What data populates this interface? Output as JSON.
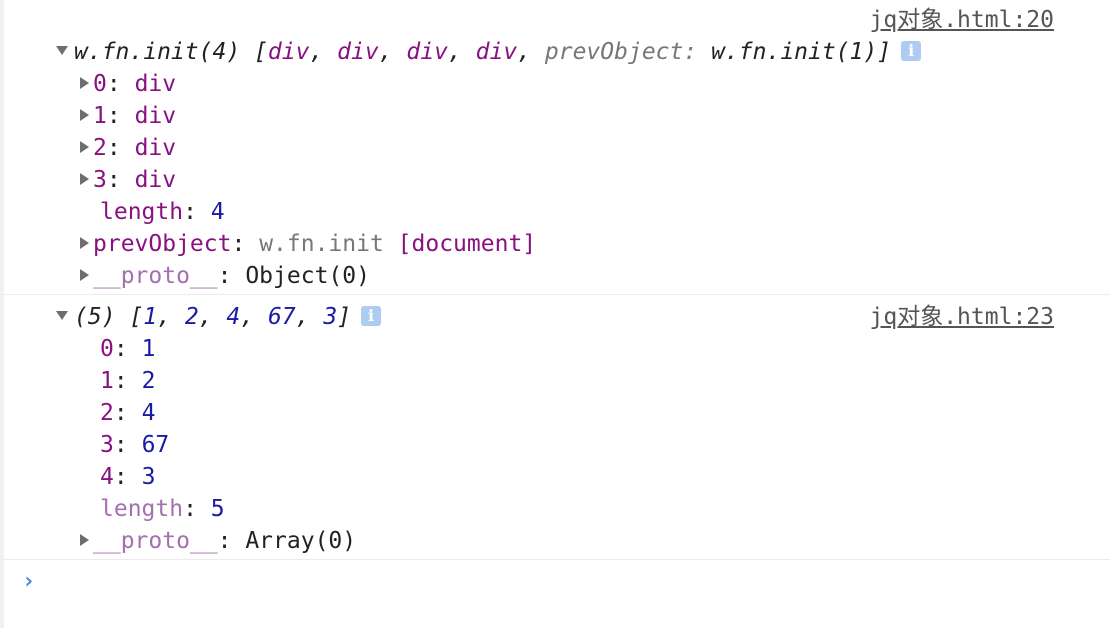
{
  "messages": [
    {
      "source": "jq对象.html:20",
      "header": {
        "ctor": "w.fn.init(4)",
        "open": "[",
        "items": [
          "div",
          "div",
          "div",
          "div"
        ],
        "sep": ", ",
        "prev_key": "prevObject",
        "colon": ": ",
        "prev_val": "w.fn.init(1)",
        "close": "]"
      },
      "children": [
        {
          "key": "0",
          "value": "div"
        },
        {
          "key": "1",
          "value": "div"
        },
        {
          "key": "2",
          "value": "div"
        },
        {
          "key": "3",
          "value": "div"
        }
      ],
      "length": {
        "key": "length",
        "value": "4"
      },
      "prev": {
        "key": "prevObject",
        "ctor": "w.fn.init",
        "value": "[document]"
      },
      "proto": {
        "key": "__proto__",
        "value": "Object(0)"
      }
    },
    {
      "source": "jq对象.html:23",
      "header": {
        "count": "(5)",
        "open": "[",
        "items": [
          "1",
          "2",
          "4",
          "67",
          "3"
        ],
        "sep": ", ",
        "close": "]"
      },
      "children": [
        {
          "key": "0",
          "value": "1"
        },
        {
          "key": "1",
          "value": "2"
        },
        {
          "key": "2",
          "value": "4"
        },
        {
          "key": "3",
          "value": "67"
        },
        {
          "key": "4",
          "value": "3"
        }
      ],
      "length": {
        "key": "length",
        "value": "5"
      },
      "proto": {
        "key": "__proto__",
        "value": "Array(0)"
      }
    }
  ],
  "console": {
    "prompt": "›",
    "info_glyph": "i"
  },
  "colors": {
    "property": "#881280",
    "number": "#1a1aa6",
    "muted": "#777777",
    "link": "#555555",
    "prompt": "#4a7fd9",
    "info_badge": "#aecbf2"
  }
}
